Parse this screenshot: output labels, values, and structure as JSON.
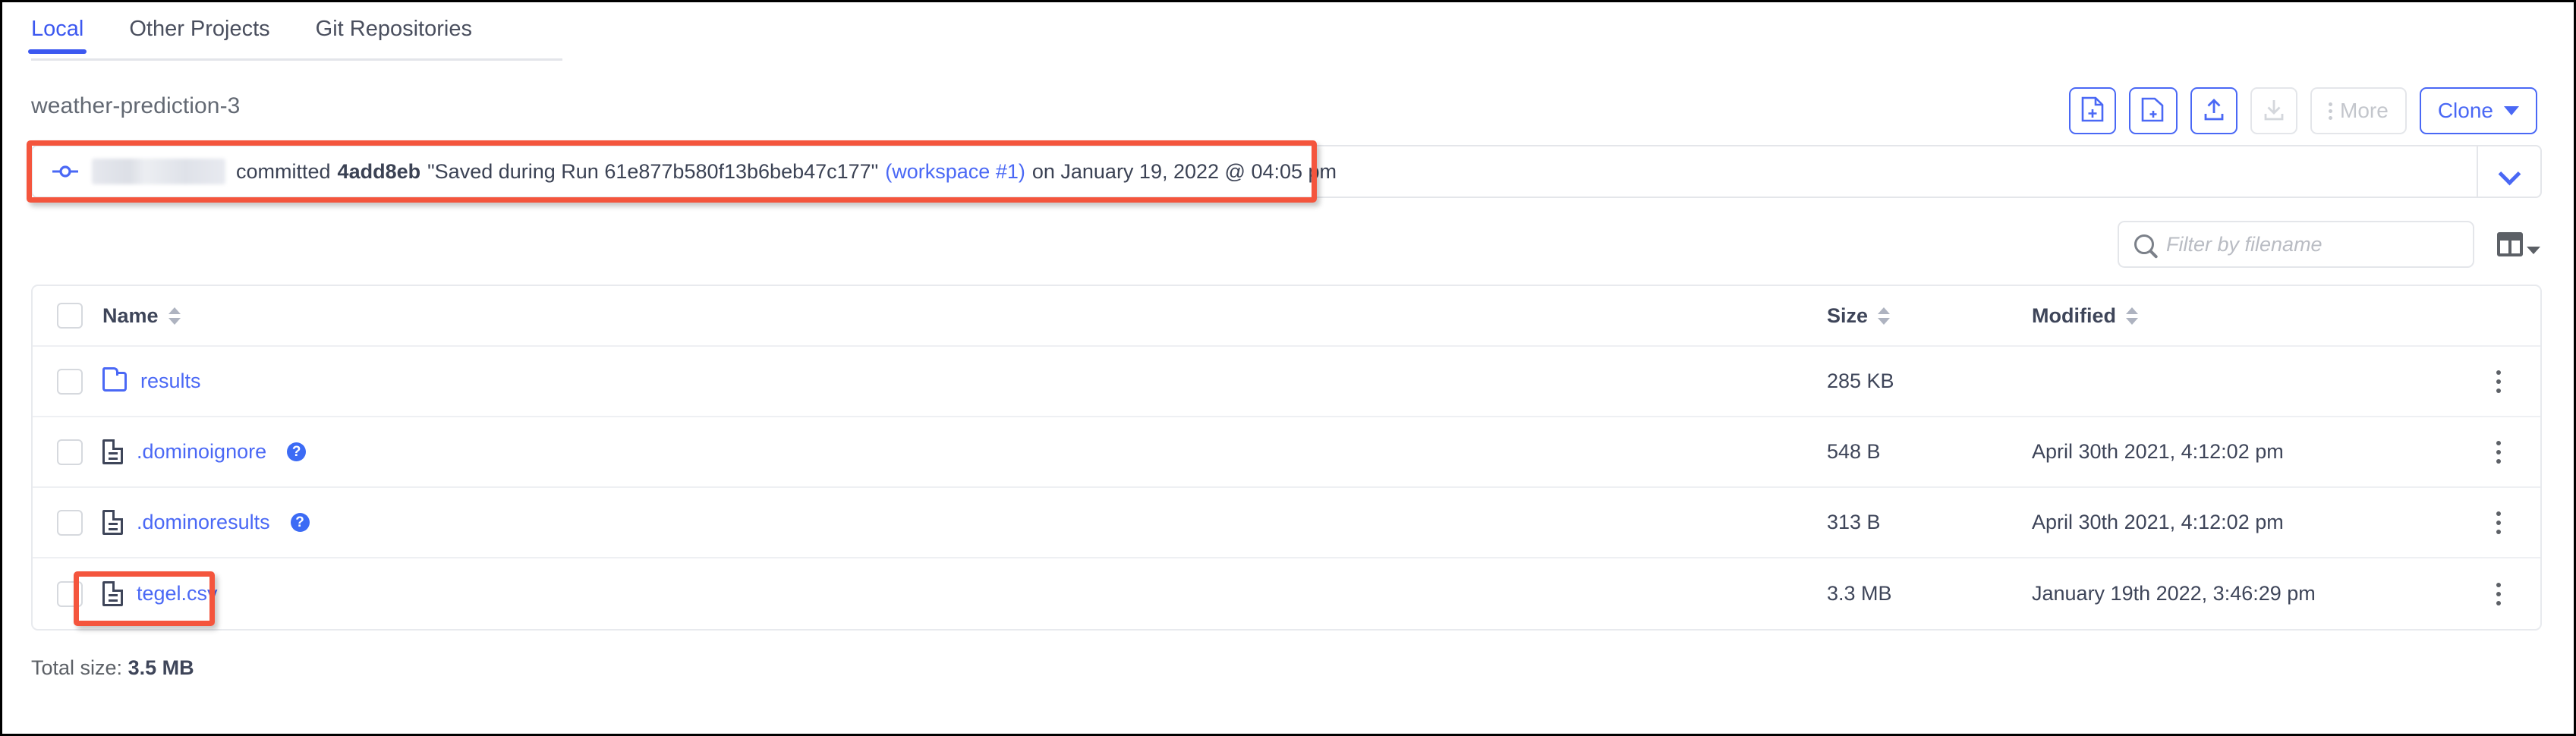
{
  "tabs": [
    {
      "label": "Local",
      "active": true
    },
    {
      "label": "Other Projects",
      "active": false
    },
    {
      "label": "Git Repositories",
      "active": false
    }
  ],
  "project": {
    "title": "weather-prediction-3"
  },
  "toolbar": {
    "new_file_icon": "file-plus-icon",
    "new_folder_icon": "folder-plus-icon",
    "upload_icon": "upload-icon",
    "download_icon": "download-icon",
    "more_label": "More",
    "clone_label": "Clone"
  },
  "commit": {
    "icon": "git-commit-icon",
    "author_redacted": "",
    "committed_label": "committed",
    "sha": "4add8eb",
    "message": "\"Saved during Run 61e877b580f13b6beb47c177\"",
    "workspace_link": "(workspace #1)",
    "timestamp": "on January 19, 2022 @ 04:05 pm",
    "expand_icon": "chevron-down-icon"
  },
  "search": {
    "placeholder": "Filter by filename",
    "value": "",
    "icon": "search-icon"
  },
  "columns_button": {
    "icon": "columns-icon"
  },
  "table": {
    "headers": {
      "name": "Name",
      "size": "Size",
      "modified": "Modified"
    },
    "rows": [
      {
        "name": "results",
        "type": "folder",
        "size": "285 KB",
        "modified": "",
        "help": false
      },
      {
        "name": ".dominoignore",
        "type": "file",
        "size": "548 B",
        "modified": "April 30th 2021, 4:12:02 pm",
        "help": true
      },
      {
        "name": ".dominoresults",
        "type": "file",
        "size": "313 B",
        "modified": "April 30th 2021, 4:12:02 pm",
        "help": true
      },
      {
        "name": "tegel.csv",
        "type": "file",
        "size": "3.3 MB",
        "modified": "January 19th 2022, 3:46:29 pm",
        "help": false
      }
    ]
  },
  "footer": {
    "total_label": "Total size:",
    "total_value": "3.5 MB"
  },
  "annotations": {
    "highlight_color": "#f4553d",
    "targets": [
      "commit-bar",
      "tegel.csv"
    ]
  },
  "colors": {
    "accent": "#4a68f5",
    "link": "#4a68f5",
    "text": "#3e4559",
    "muted": "#8b9099",
    "border": "#e4e6ea"
  }
}
